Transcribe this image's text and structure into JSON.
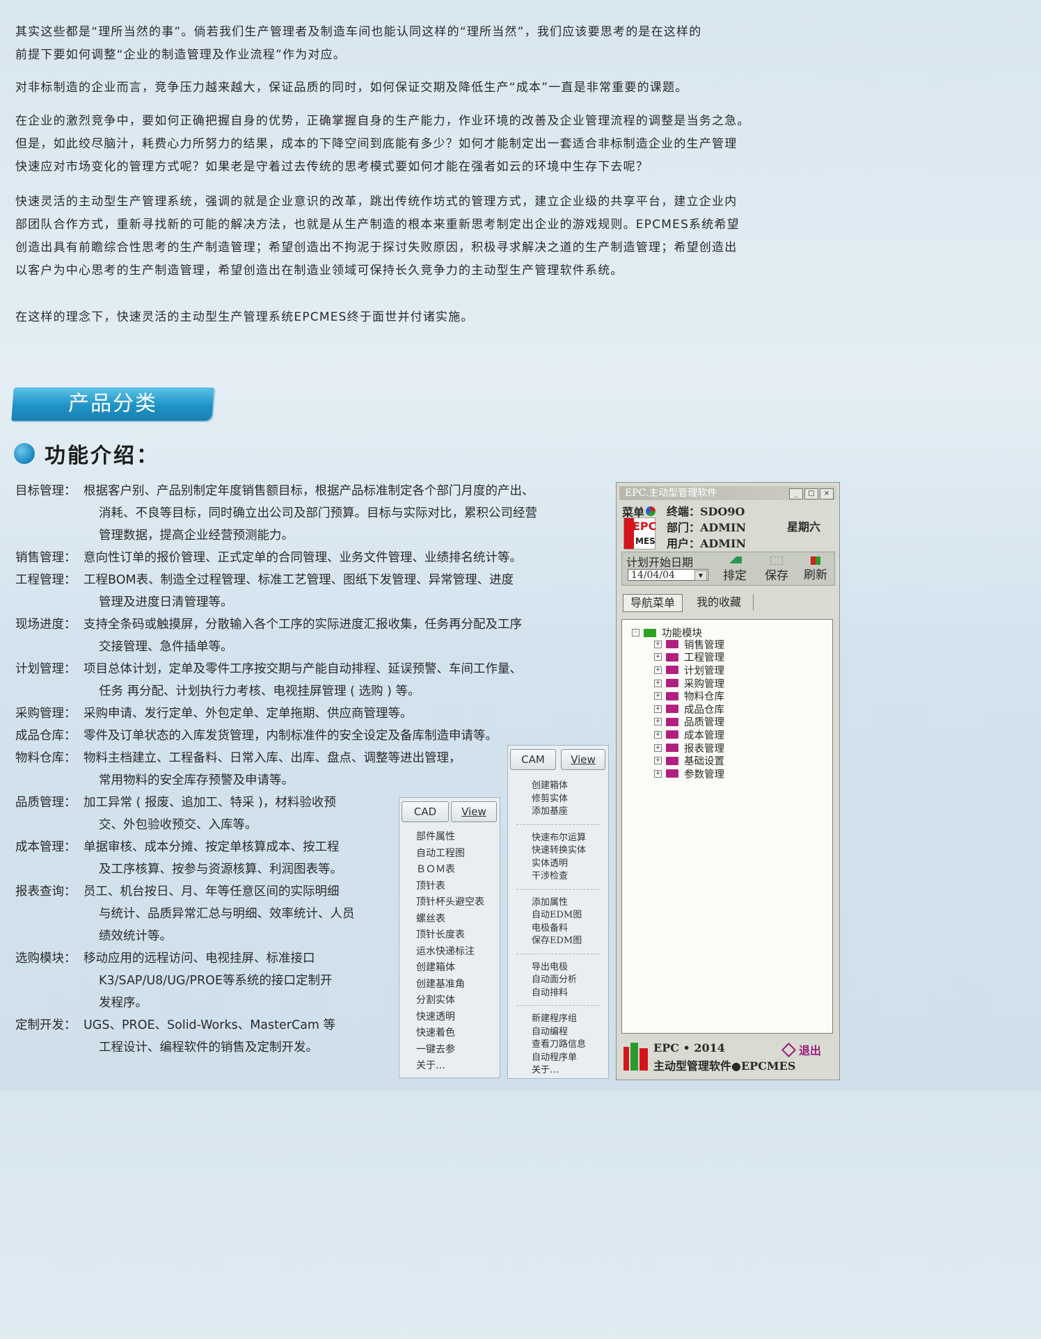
{
  "intro_paragraphs": [
    [
      "其实这些都是“理所当然的事”。倘若我们生产管理者及制造车间也能认同这样的“理所当然”，我们应该要思考的是在这样的",
      "前提下要如何调整“企业的制造管理及作业流程”作为对应。"
    ],
    [
      "对非标制造的企业而言，竞争压力越来越大，保证品质的同时，如何保证交期及降低生产“成本”一直是非常重要的课题。"
    ],
    [
      "在企业的激烈竞争中，要如何正确把握自身的优势，正确掌握自身的生产能力，作业环境的改善及企业管理流程的调整是当务之急。",
      "但是，如此绞尽脑汁，耗费心力所努力的结果，成本的下降空间到底能有多少？如何才能制定出一套适合非标制造企业的生产管理",
      "快速应对市场变化的管理方式呢？如果老是守着过去传统的思考模式要如何才能在强者如云的环境中生存下去呢？"
    ],
    [
      "快速灵活的主动型生产管理系统，强调的就是企业意识的改革，跳出传统作坊式的管理方式，建立企业级的共享平台，建立企业内",
      "部团队合作方式，重新寻找新的可能的解决方法，也就是从生产制造的根本来重新思考制定出企业的游戏规则。EPCMES系统希望",
      "创造出具有前瞻综合性思考的生产制造管理；希望创造出不拘泥于探讨失败原因，积极寻求解决之道的生产制造管理；希望创造出",
      "以客户为中心思考的生产制造管理，希望创造出在制造业领域可保持长久竞争力的主动型生产管理软件系统。"
    ],
    [
      "在这样的理念下，快速灵活的主动型生产管理系统EPCMES终于面世并付诸实施。"
    ]
  ],
  "section_banner": "产品分类",
  "function_title": "功能介绍：",
  "features": [
    {
      "label": "目标管理：",
      "lines": [
        "根据客户别、产品别制定年度销售额目标，根据产品标准制定各个部门月度的产出、",
        "消耗、不良等目标，同时确立出公司及部门预算。目标与实际对比，累积公司经营",
        "管理数据，提高企业经营预测能力。"
      ]
    },
    {
      "label": "销售管理：",
      "lines": [
        "意向性订单的报价管理、正式定单的合同管理、业务文件管理、业绩排名统计等。"
      ]
    },
    {
      "label": "工程管理：",
      "lines": [
        "工程BOM表、制造全过程管理、标准工艺管理、图纸下发管理、异常管理、进度",
        "管理及进度日清管理等。"
      ]
    },
    {
      "label": "现场进度：",
      "lines": [
        "支持全条码或触摸屏，分散输入各个工序的实际进度汇报收集，任务再分配及工序",
        "交接管理、急件插单等。"
      ]
    },
    {
      "label": "计划管理：",
      "lines": [
        "项目总体计划，定单及零件工序按交期与产能自动排程、延误预警、车间工作量、",
        "任务 再分配、计划执行力考核、电视挂屏管理 ( 选购 ) 等。"
      ]
    },
    {
      "label": "采购管理：",
      "lines": [
        "采购申请、发行定单、外包定单、定单拖期、供应商管理等。"
      ]
    },
    {
      "label": "成品仓库：",
      "lines": [
        "零件及订单状态的入库发货管理，内制标准件的安全设定及备库制造申请等。"
      ]
    },
    {
      "label": "物料仓库：",
      "lines": [
        "物料主档建立、工程备料、日常入库、出库、盘点、调整等进出管理，",
        "常用物料的安全库存预警及申请等。"
      ]
    },
    {
      "label": "品质管理：",
      "lines": [
        "加工异常 ( 报废、追加工、特采 )，材料验收预",
        "交、外包验收预交、入库等。"
      ]
    },
    {
      "label": "成本管理：",
      "lines": [
        "单据审核、成本分摊、按定单核算成本、按工程",
        "及工序核算、按参与资源核算、利润图表等。"
      ]
    },
    {
      "label": "报表查询：",
      "lines": [
        "员工、机台按日、月、年等任意区间的实际明细",
        "与统计、品质异常汇总与明细、效率统计、人员",
        "绩效统计等。"
      ]
    },
    {
      "label": "选购模块：",
      "lines": [
        "移动应用的远程访问、电视挂屏、标准接口",
        "K3/SAP/U8/UG/PROE等系统的接口定制开",
        "发程序。"
      ]
    },
    {
      "label": "定制开发：",
      "lines": [
        "UGS、PROE、Solid-Works、MasterCam 等",
        "工程设计、编程软件的销售及定制开发。"
      ]
    }
  ],
  "cad_panel": {
    "tab": "CAD",
    "view": "View",
    "items": [
      "部件属性",
      "自动工程图",
      "ＢＯＭ表",
      "顶针表",
      "顶针杯头避空表",
      "螺丝表",
      "顶针长度表",
      "运水快递标注",
      "创建箱体",
      "创建基准角",
      "分割实体",
      "快速透明",
      "快速着色",
      "一键去参",
      "关于…"
    ]
  },
  "cam_panel": {
    "tab": "CAM",
    "view": "View",
    "groups": [
      [
        "创建箱体",
        "修剪实体",
        "添加基座"
      ],
      [
        "快速布尔运算",
        "快速转换实体",
        "实体透明",
        "干涉检查"
      ],
      [
        "添加属性",
        "自动EDM图",
        "电极备料",
        "保存EDM图"
      ],
      [
        "导出电极",
        "自动面分析",
        "自动排料"
      ],
      [
        "新建程序组",
        "自动编程",
        "查看刀路信息",
        "自动程序单",
        "关于…"
      ]
    ]
  },
  "epc_window": {
    "title": "EPC.主动型管理软件",
    "menu_label": "菜单",
    "logo_top": "EPC",
    "logo_bottom": "MES",
    "terminal": "终端：SDO9O",
    "department": "部门：ADMIN",
    "user": "用户：ADMIN",
    "weekday": "星期六",
    "plan_date_label": "计划开始日期",
    "plan_date_value": "14/04/04",
    "btn_schedule": "排定",
    "btn_save": "保存",
    "btn_refresh": "刷新",
    "tab_nav": "导航菜单",
    "tab_fav": "我的收藏",
    "tree_root": "功能模块",
    "tree_items": [
      "销售管理",
      "工程管理",
      "计划管理",
      "采购管理",
      "物料仓库",
      "成品仓库",
      "品质管理",
      "成本管理",
      "报表管理",
      "基础设置",
      "参数管理"
    ],
    "footer_line1": "EPC • 2014",
    "footer_line2": "主动型管理软件●EPCMES",
    "exit": "退出",
    "colors": {
      "folder": "#b2207f",
      "root_folder": "#2fa31f",
      "logo_red": "#d6141c"
    }
  }
}
